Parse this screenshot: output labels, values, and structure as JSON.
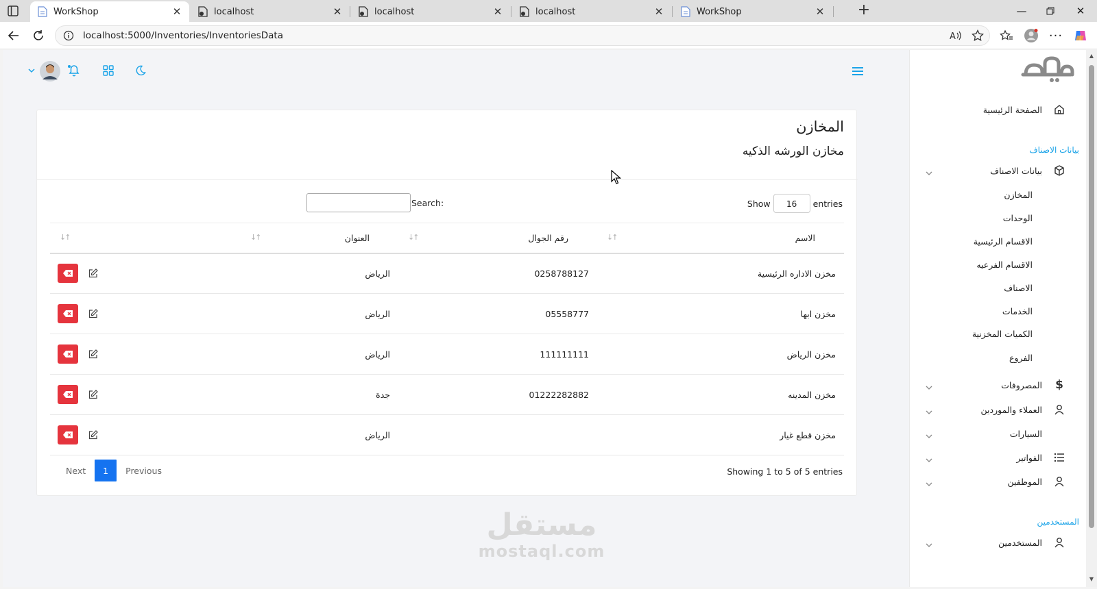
{
  "browser": {
    "tabs": [
      {
        "title": "WorkShop",
        "active": true,
        "favicon": "page-icon"
      },
      {
        "title": "localhost",
        "active": false,
        "favicon": "shield-page-icon"
      },
      {
        "title": "localhost",
        "active": false,
        "favicon": "shield-page-icon"
      },
      {
        "title": "localhost",
        "active": false,
        "favicon": "shield-page-icon"
      },
      {
        "title": "WorkShop",
        "active": false,
        "favicon": "page-icon"
      }
    ],
    "url": "localhost:5000/Inventories/InventoriesData"
  },
  "sidebar": {
    "home": "الصفحة الرئيسية",
    "section_items": "بيانات الاصناف",
    "items_group": "بيانات الاصناف",
    "sub_items": [
      "المخازن",
      "الوحدات",
      "الاقسام الرئيسية",
      "الاقسام الفرعيه",
      "الاصناف",
      "الخدمات",
      "الكميات المخزنية",
      "الفروع"
    ],
    "expenses": "المصروفات",
    "customers": "العملاء والموردين",
    "cars": "السيارات",
    "invoices": "الفواتير",
    "employees": "الموظفين",
    "section_users": "المستخدمين",
    "users": "المستخدمين"
  },
  "card": {
    "title": "المخازن",
    "subtitle": "مخازن الورشه الذكيه"
  },
  "datatable": {
    "show_label": "Show",
    "entries_label": "entries",
    "length_value": "16",
    "search_label": "Search:",
    "columns": [
      "الاسم",
      "رقم الجوال",
      "العنوان",
      ""
    ],
    "rows": [
      {
        "name": "مخزن الاداره الرئيسية",
        "phone": "0258788127",
        "address": "الرياض"
      },
      {
        "name": "مخزن ابها",
        "phone": "05558777",
        "address": "الرياض"
      },
      {
        "name": "مخزن الرياض",
        "phone": "111111111",
        "address": "الرياض"
      },
      {
        "name": "مخزن المدينه",
        "phone": "01222282882",
        "address": "جدة"
      },
      {
        "name": "مخزن قطع غيار",
        "phone": "",
        "address": "الرياض"
      }
    ],
    "info": "Showing 1 to 5 of 5 entries",
    "pager": {
      "next": "Next",
      "current": "1",
      "previous": "Previous"
    }
  },
  "watermark": {
    "arabic": "مستقل",
    "latin": "mostaql.com"
  },
  "colors": {
    "accent": "#1aa3e8",
    "danger": "#e5343d",
    "primary": "#1573f0"
  }
}
